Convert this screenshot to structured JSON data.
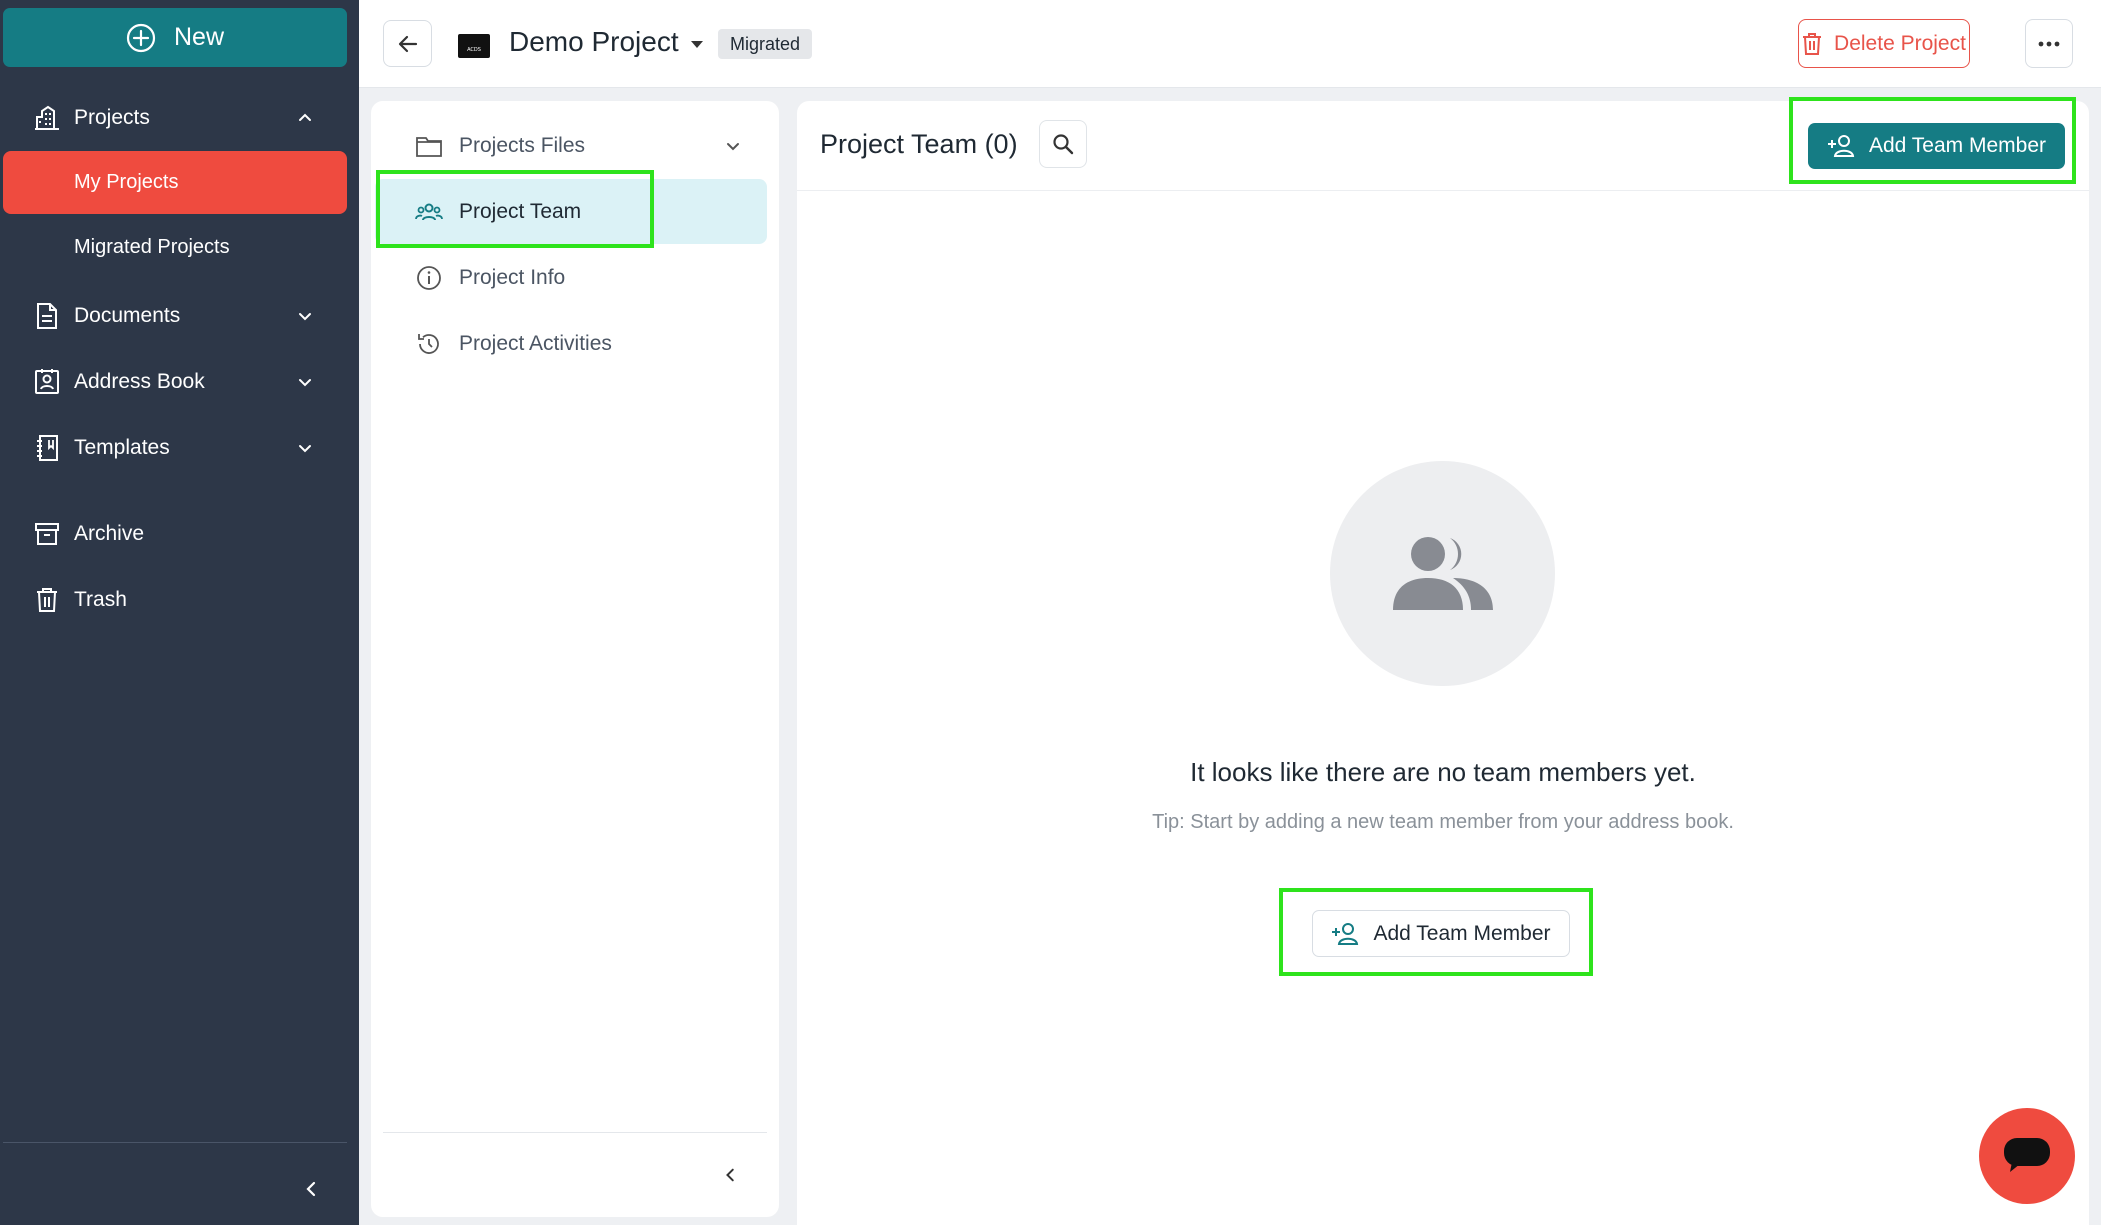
{
  "sidebar": {
    "new_label": "New",
    "projects": {
      "label": "Projects",
      "expanded": true
    },
    "sub_items": [
      {
        "label": "My Projects",
        "active": true
      },
      {
        "label": "Migrated Projects",
        "active": false
      }
    ],
    "items": [
      {
        "label": "Documents",
        "icon": "document-icon"
      },
      {
        "label": "Address Book",
        "icon": "address-book-icon"
      },
      {
        "label": "Templates",
        "icon": "templates-icon"
      },
      {
        "label": "Archive",
        "icon": "archive-icon"
      },
      {
        "label": "Trash",
        "icon": "trash-icon"
      }
    ]
  },
  "header": {
    "project_title": "Demo Project",
    "logo_text": "ACDS",
    "badge": "Migrated",
    "delete_label": "Delete Project"
  },
  "left_panel": {
    "items": [
      {
        "label": "Projects Files",
        "icon": "folder-icon"
      },
      {
        "label": "Project Team",
        "icon": "team-icon",
        "active": true
      },
      {
        "label": "Project Info",
        "icon": "info-icon"
      },
      {
        "label": "Project Activities",
        "icon": "history-icon"
      }
    ]
  },
  "main": {
    "title": "Project Team (0)",
    "add_member_label": "Add Team Member",
    "empty_title": "It looks like there are no team members yet.",
    "empty_tip": "Tip: Start by adding a new team member from your address book.",
    "add_member_label_secondary": "Add Team Member"
  },
  "colors": {
    "sidebar_bg": "#2d3748",
    "primary_teal": "#157c84",
    "active_red": "#ef4b3f",
    "highlight_green": "#2ee31c"
  }
}
